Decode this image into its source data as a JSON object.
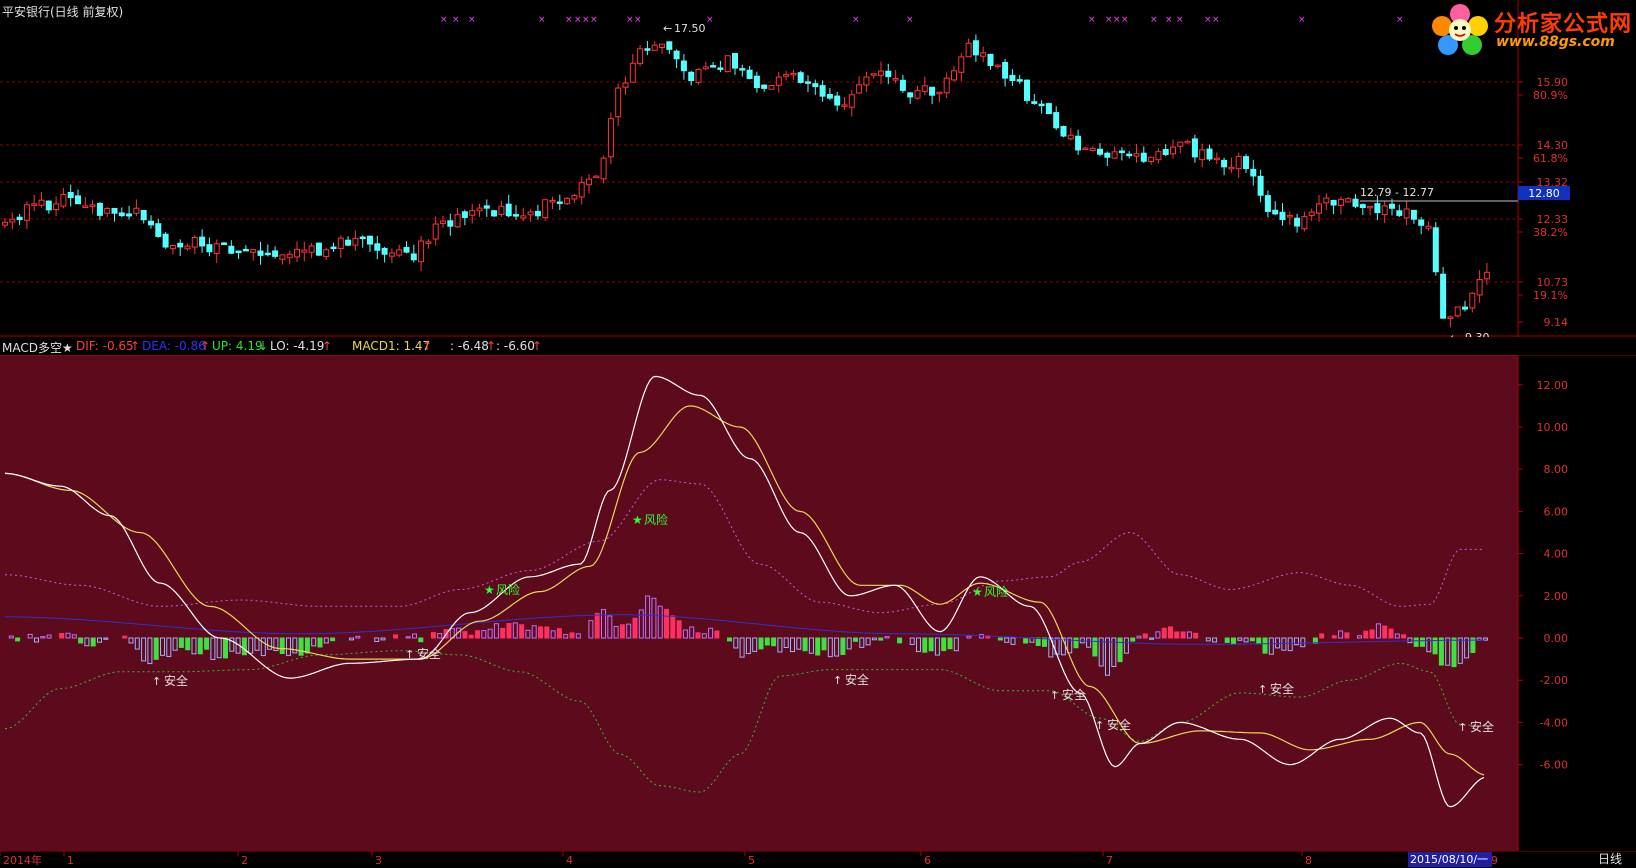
{
  "window": {
    "title": "平安银行(日线 前复权)",
    "logo_text": "分析家公式网",
    "logo_url": "www.88gs.com"
  },
  "price_axis": {
    "labels": [
      "15.90",
      "80.9%",
      "14.30",
      "61.8%",
      "13.32",
      "12.33",
      "38.2%",
      "10.73",
      "19.1%",
      "9.14"
    ],
    "current_price": "12.80"
  },
  "price_annotations": {
    "high": "17.50",
    "low": "9.30",
    "range": "12.79 - 12.77",
    "signal": "$"
  },
  "indicator": {
    "name": "MACD多空★",
    "dif": "DIF: -0.65",
    "dea": "DEA: -0.86",
    "up": "UP: 4.19",
    "lo": "LO: -4.19",
    "macd1": "MACD1: 1.47",
    "v5": ": -6.48",
    "v6": ": -6.60",
    "arrow_up": "↑",
    "arrow_down": "↓"
  },
  "indicator_axis": [
    "12.00",
    "10.00",
    "8.00",
    "6.00",
    "4.00",
    "2.00",
    "0.00",
    "-2.00",
    "-4.00",
    "-6.00"
  ],
  "signals": {
    "safe": "安全",
    "risk": "风险",
    "star": "★",
    "mark": "×"
  },
  "time_axis": {
    "labels": [
      "2014年",
      "1",
      "2",
      "3",
      "4",
      "5",
      "6",
      "7",
      "8",
      "9"
    ],
    "cursor_date": "2015/08/10/一",
    "period": "日线"
  },
  "colors": {
    "up": "#ff3333",
    "down": "#54ffff",
    "indicator_bg": "#5c0a1c",
    "grid": "#7a1010",
    "dif": "#ffffff",
    "dea": "#e8d85a",
    "up_band": "#c060e0",
    "lo_band": "#30c030",
    "hist_pos": "#ff3060",
    "hist_pos_outline": "#c070ff",
    "hist_neg": "#40e040",
    "hist_neg_outline": "#a0b0ff"
  }
}
